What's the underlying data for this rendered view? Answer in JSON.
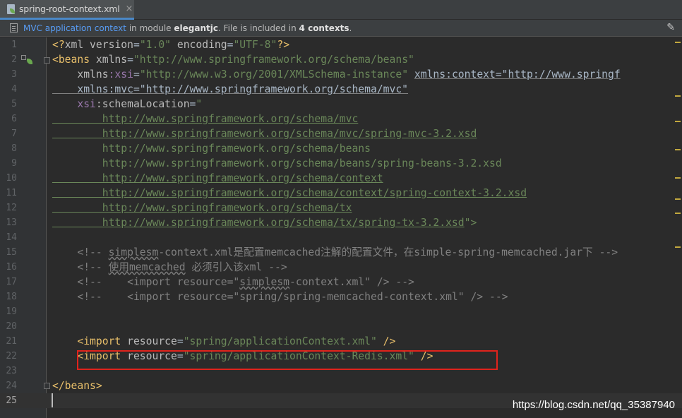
{
  "tab": {
    "title": "spring-root-context.xml",
    "close": "×"
  },
  "infobar": {
    "context_link": "MVC application context",
    "t1": " in module ",
    "module": "elegantjc",
    "t2": ". File is included in ",
    "count": "4 contexts",
    "t3": ".",
    "settings_icon": "wrench-icon"
  },
  "editor": {
    "lines": [
      {
        "n": "1"
      },
      {
        "n": "2"
      },
      {
        "n": "3"
      },
      {
        "n": "4"
      },
      {
        "n": "5"
      },
      {
        "n": "6"
      },
      {
        "n": "7"
      },
      {
        "n": "8"
      },
      {
        "n": "9"
      },
      {
        "n": "10"
      },
      {
        "n": "11"
      },
      {
        "n": "12"
      },
      {
        "n": "13"
      },
      {
        "n": "14"
      },
      {
        "n": "15"
      },
      {
        "n": "16"
      },
      {
        "n": "17"
      },
      {
        "n": "18"
      },
      {
        "n": "19"
      },
      {
        "n": "20"
      },
      {
        "n": "21"
      },
      {
        "n": "22"
      },
      {
        "n": "23"
      },
      {
        "n": "24"
      },
      {
        "n": "25"
      }
    ],
    "tokens": {
      "l1_a": "<?",
      "l1_b": "xml version",
      "l1_c": "=",
      "l1_d": "\"1.0\"",
      "l1_e": " encoding",
      "l1_f": "=",
      "l1_g": "\"UTF-8\"",
      "l1_h": "?>",
      "l2_a": "<beans",
      "l2_b": " xmlns",
      "l2_c": "=",
      "l2_d": "\"http://www.springframework.org/schema/beans\"",
      "l3_a": "    xmlns",
      "l3_b": ":xsi",
      "l3_c": "=",
      "l3_d": "\"http://www.w3.org/2001/XMLSchema-instance\"",
      "l3_e": " ",
      "l3_f": "xmlns:context=\"http://www.springf",
      "l4_a": "    xmlns:mvc=\"http://www.springframework.org/schema/mvc\"",
      "l5_a": "    xsi",
      "l5_b": ":schemaLocation",
      "l5_c": "=",
      "l5_d": "\"",
      "l6": "        http://www.springframework.org/schema/mvc",
      "l7": "        http://www.springframework.org/schema/mvc/spring-mvc-3.2.xsd",
      "l8": "        http://www.springframework.org/schema/beans",
      "l9": "        http://www.springframework.org/schema/beans/spring-beans-3.2.xsd",
      "l10": "        http://www.springframework.org/schema/context",
      "l11": "        http://www.springframework.org/schema/context/spring-context-3.2.xsd",
      "l12": "        http://www.springframework.org/schema/tx",
      "l13_a": "        http://www.springframework.org/schema/tx/spring-tx-3.2.xsd",
      "l13_b": "\">",
      "l15_a": "    <!-- ",
      "l15_b": "simplesm",
      "l15_c": "-context.xml是配置memcached注解的配置文件，在simple-spring-memcached.jar下 -->",
      "l16_a": "    <!-- ",
      "l16_b": "使用memcached",
      "l16_c": " 必须引入该xml -->",
      "l17_a": "    <!--    <import resource=\"",
      "l17_b": "simplesm",
      "l17_c": "-context.xml\" /> -->",
      "l18": "    <!--    <import resource=\"spring/spring-memcached-context.xml\" /> -->",
      "l21_a": "    <import",
      "l21_b": " resource",
      "l21_c": "=",
      "l21_d": "\"spring/applicationContext.xml\"",
      "l21_e": " />",
      "l22_a": "    <import",
      "l22_b": " resource",
      "l22_c": "=",
      "l22_d": "\"spring/applicationContext-Redis.xml\"",
      "l22_e": " />",
      "l24": "</beans>"
    }
  },
  "watermark": "https://blog.csdn.net/qq_35387940",
  "colors": {
    "tag": "#e8bf6a",
    "value": "#6a8759",
    "comment": "#808080",
    "highlight": "#e0231c"
  }
}
